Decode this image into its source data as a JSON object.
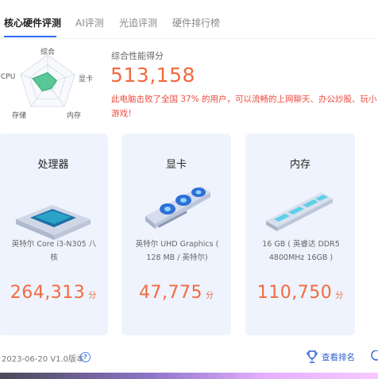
{
  "tabs": [
    {
      "label": "核心硬件评测",
      "active": true
    },
    {
      "label": "AI评测",
      "active": false
    },
    {
      "label": "光追评测",
      "active": false
    },
    {
      "label": "硬件排行榜",
      "active": false
    }
  ],
  "radar": {
    "labels": {
      "top": "综合",
      "right": "显卡",
      "bottom_right": "内存",
      "bottom_left": "存储",
      "left": "CPU"
    },
    "values": {
      "top": 0.38,
      "right": 0.33,
      "bottom_right": 0.22,
      "bottom_left": 0.32,
      "left": 0.55
    }
  },
  "score": {
    "title": "综合性能得分",
    "value": "513,158",
    "desc": "此电脑击败了全国 37% 的用户，可以流畅的上网聊天、办公炒股、玩小游戏！"
  },
  "cards": [
    {
      "title": "处理器",
      "desc": "英特尔 Core i3-N305 八核",
      "score": "264,313",
      "unit": "分",
      "icon": "cpu-chip-icon"
    },
    {
      "title": "显卡",
      "desc": "英特尔 UHD Graphics ( 128 MB / 英特尔)",
      "score": "47,775",
      "unit": "分",
      "icon": "graphics-card-icon"
    },
    {
      "title": "内存",
      "desc": "16 GB ( 英睿达 DDR5 4800MHz 16GB )",
      "score": "110,750",
      "unit": "分",
      "icon": "memory-stick-icon"
    }
  ],
  "footer": {
    "version": "2023-06-20 V1.0版本",
    "help": "?",
    "rank_label": "查看排名"
  },
  "colors": {
    "accent": "#2f6cf6",
    "score": "#f26a3f",
    "desc": "#ee4a3c",
    "card_bg": "#eef3fd",
    "radar_fill": "#3fbf86"
  }
}
